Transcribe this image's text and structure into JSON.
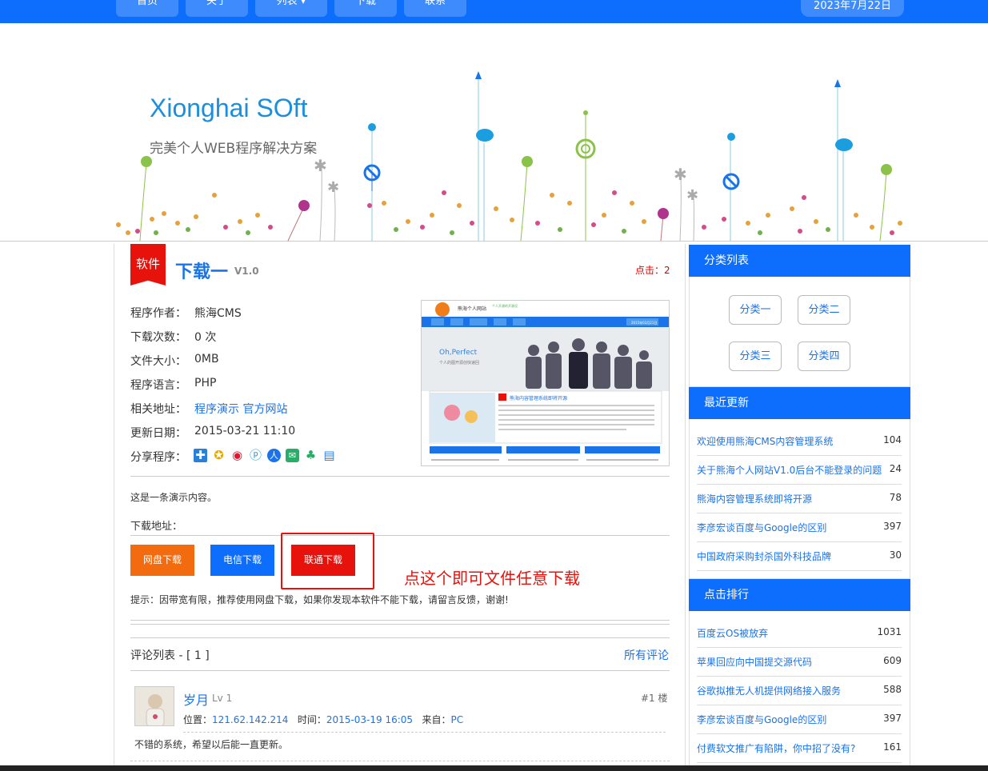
{
  "nav": {
    "items": [
      "首页",
      "关于",
      "列表 ▾",
      "下载",
      "联系"
    ],
    "date": "2023年7月22日"
  },
  "banner": {
    "brand": "Xionghai SOft",
    "slogan": "完美个人WEB程序解决方案"
  },
  "article": {
    "category_ribbon": "软件",
    "title": "下载一",
    "version": "V1.0",
    "clicks": "点击：2",
    "info": [
      {
        "label": "程序作者：",
        "value": "熊海CMS"
      },
      {
        "label": "下载次数：",
        "value": "0 次"
      },
      {
        "label": "文件大小：",
        "value": "0MB"
      },
      {
        "label": "程序语言：",
        "value": "PHP"
      },
      {
        "label": "相关地址：",
        "value": "程序演示 官方网站"
      },
      {
        "label": "更新日期：",
        "value": "2015-03-21 11:10"
      },
      {
        "label": "分享程序：",
        "value": ""
      }
    ],
    "related_links": [
      "程序演示",
      "官方网站"
    ],
    "share_icons": [
      "qzone-icon",
      "favorite-star-icon",
      "weibo-icon",
      "pengyou-icon",
      "renren-icon",
      "wechat-icon",
      "clover-icon",
      "print-icon"
    ],
    "thumb": {
      "site_name": "熊海个人网站",
      "slogan_small": "个人开源的开源设",
      "oh_perfect": "Oh,Perfect",
      "sub": "个人的图开源创快速回",
      "news_title": "熊海内容管理系统即将开源",
      "date": "2015年03月21日"
    },
    "content": "这是一条演示内容。",
    "download_label": "下载地址：",
    "buttons": {
      "pan": "网盘下载",
      "dianxin": "电信下载",
      "liantong": "联通下载"
    },
    "annotation": "点这个即可文件任意下载",
    "tip": "提示：因带宽有限，推荐使用网盘下载，如果你发现本软件不能下载，请留言反馈，谢谢!"
  },
  "comments": {
    "header": "评论列表 - [ 1 ]",
    "all_link": "所有评论",
    "items": [
      {
        "name": "岁月",
        "level": "Lv 1",
        "floor": "#1 楼",
        "location_label": "位置：",
        "location": "121.62.142.214",
        "time_label": "时间：",
        "time": "2015-03-19 16:05",
        "source_label": "来自：",
        "source": "PC",
        "text": "不错的系统，希望以后能一直更新。"
      }
    ]
  },
  "sidebar": {
    "categories_title": "分类列表",
    "categories": [
      "分类一",
      "分类二",
      "分类三",
      "分类四"
    ],
    "recent_title": "最近更新",
    "recent": [
      {
        "title": "欢迎使用熊海CMS内容管理系统",
        "count": "104"
      },
      {
        "title": "关于熊海个人网站V1.0后台不能登录的问题",
        "count": "24"
      },
      {
        "title": "熊海内容管理系统即将开源",
        "count": "78"
      },
      {
        "title": "李彦宏谈百度与Google的区别",
        "count": "397"
      },
      {
        "title": "中国政府采购封杀国外科技品牌",
        "count": "30"
      }
    ],
    "rank_title": "点击排行",
    "rank": [
      {
        "title": "百度云OS被放弃",
        "count": "1031"
      },
      {
        "title": "苹果回应向中国提交源代码",
        "count": "609"
      },
      {
        "title": "谷歌拟推无人机提供网络接入服务",
        "count": "588"
      },
      {
        "title": "李彦宏谈百度与Google的区别",
        "count": "397"
      },
      {
        "title": "付费软文推广有陷阱，你中招了没有?",
        "count": "161"
      }
    ]
  },
  "colors": {
    "primary": "#0d6efd",
    "red": "#e8120c",
    "orange": "#f26b0f",
    "link": "#1a73e8"
  }
}
